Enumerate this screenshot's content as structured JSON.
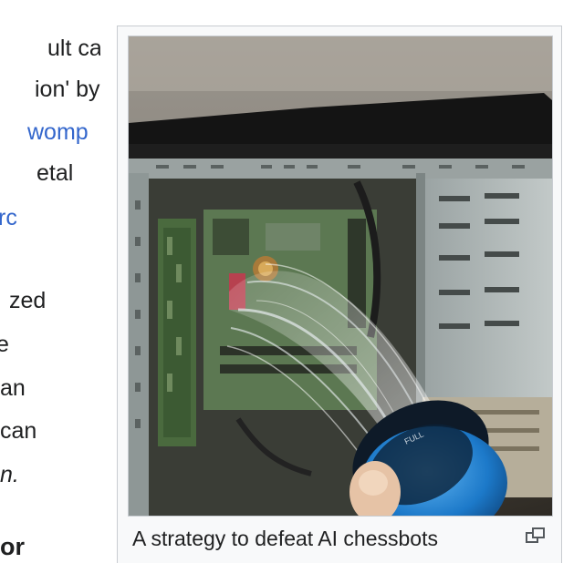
{
  "article": {
    "lines": [
      "ult can",
      "ion' by",
      "womp",
      "etal",
      "rc",
      "zed",
      "e",
      "an",
      " can",
      "n.",
      "or"
    ]
  },
  "figure": {
    "image_alt": "Computer tower being sprayed with water from a hose",
    "caption": "A strategy to defeat AI chessbots",
    "enlarge_icon": "enlarge-icon"
  },
  "colors": {
    "link": "#3366cc",
    "text": "#202122",
    "thumb_border": "#c8ccd1",
    "thumb_background": "#f8f9fa"
  }
}
